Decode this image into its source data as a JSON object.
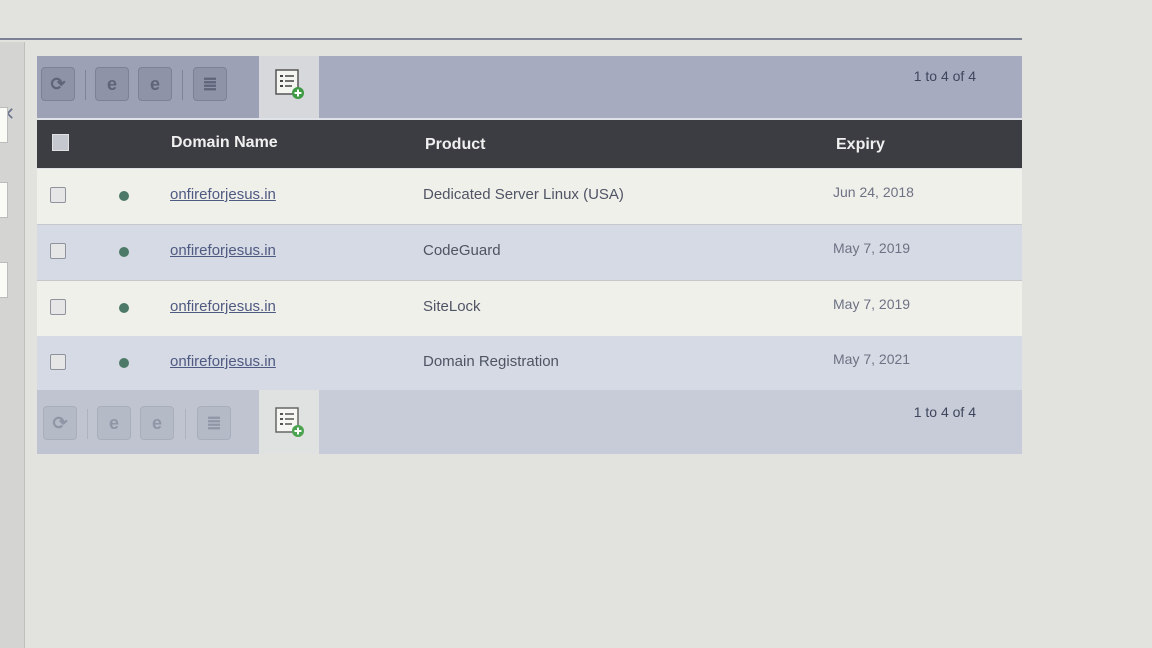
{
  "pager_text": "1 to 4 of 4",
  "toolbar": {
    "buttons": [
      {
        "name": "refresh-button",
        "icon": "refresh-icon",
        "glyph": "⟳"
      },
      {
        "name": "edit-button",
        "icon": "edit-icon",
        "glyph": "e"
      },
      {
        "name": "edit-alt-button",
        "icon": "edit-alt-icon",
        "glyph": "e"
      },
      {
        "name": "list-button",
        "icon": "list-icon",
        "glyph": "≣"
      }
    ],
    "add_icon": "add-order-icon"
  },
  "table": {
    "columns": [
      "Domain Name",
      "Product",
      "Expiry"
    ],
    "rows": [
      {
        "domain": "onfireforjesus.in",
        "product": "Dedicated Server Linux (USA)",
        "expiry": "Jun 24, 2018",
        "status_color": "#4d7a68"
      },
      {
        "domain": "onfireforjesus.in",
        "product": "CodeGuard",
        "expiry": "May 7, 2019",
        "status_color": "#4d7a68"
      },
      {
        "domain": "onfireforjesus.in",
        "product": "SiteLock",
        "expiry": "May 7, 2019",
        "status_color": "#4d7a68"
      },
      {
        "domain": "onfireforjesus.in",
        "product": "Domain Registration",
        "expiry": "May 7, 2021",
        "status_color": "#4d7a68"
      }
    ]
  },
  "colors": {
    "header_bg": "#3c3d42",
    "toolbar_bg": "#a6abc0",
    "row_alt_bg": "#d5dae4",
    "link": "#4f5a82"
  }
}
